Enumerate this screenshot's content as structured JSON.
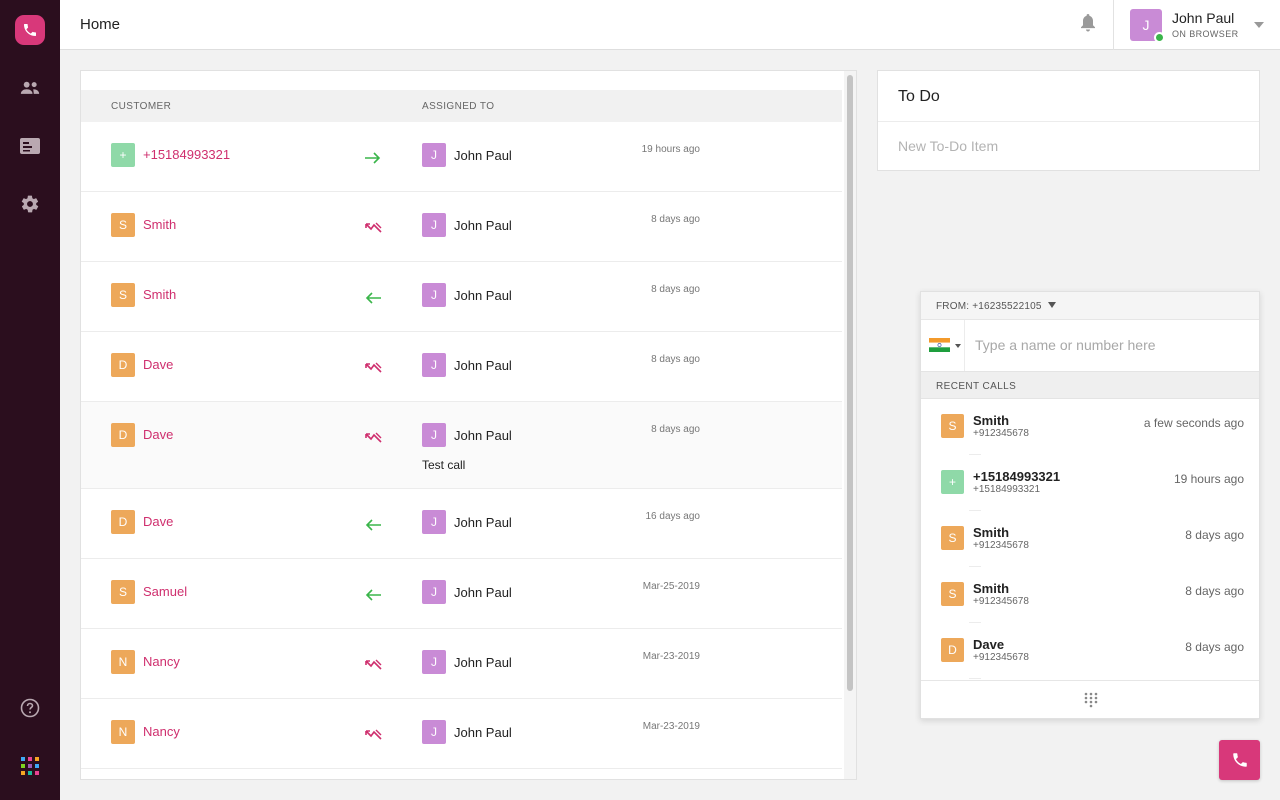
{
  "app": {
    "brand_color": "#d8387a",
    "rail_color": "#2b0e1e",
    "customer_name_color": "#cf2f6e",
    "nav": [
      {
        "icon": "phone-logo-icon"
      },
      {
        "icon": "contacts-icon"
      },
      {
        "icon": "contact-card-icon"
      },
      {
        "icon": "settings-gear-icon"
      },
      {
        "icon": "help-icon"
      },
      {
        "icon": "apps-grid-icon"
      }
    ]
  },
  "header": {
    "title": "Home",
    "user": {
      "initial": "J",
      "name": "John Paul",
      "status": "ON BROWSER",
      "status_color": "#3ab54a"
    }
  },
  "activity": {
    "columns": {
      "customer": "CUSTOMER",
      "assigned_to": "ASSIGNED TO"
    },
    "rows": [
      {
        "initial": "+",
        "avatar_color": "#8fd9a8",
        "customer": "+15184993321",
        "direction": "outgoing",
        "assignee_initial": "J",
        "assignee": "John Paul",
        "time": "19 hours ago",
        "note": ""
      },
      {
        "initial": "S",
        "avatar_color": "#eda85a",
        "customer": "Smith",
        "direction": "missed",
        "assignee_initial": "J",
        "assignee": "John Paul",
        "time": "8 days ago",
        "note": ""
      },
      {
        "initial": "S",
        "avatar_color": "#eda85a",
        "customer": "Smith",
        "direction": "incoming",
        "assignee_initial": "J",
        "assignee": "John Paul",
        "time": "8 days ago",
        "note": ""
      },
      {
        "initial": "D",
        "avatar_color": "#eda85a",
        "customer": "Dave",
        "direction": "missed",
        "assignee_initial": "J",
        "assignee": "John Paul",
        "time": "8 days ago",
        "note": ""
      },
      {
        "initial": "D",
        "avatar_color": "#eda85a",
        "customer": "Dave",
        "direction": "missed",
        "assignee_initial": "J",
        "assignee": "John Paul",
        "time": "8 days ago",
        "note": "Test call"
      },
      {
        "initial": "D",
        "avatar_color": "#eda85a",
        "customer": "Dave",
        "direction": "incoming",
        "assignee_initial": "J",
        "assignee": "John Paul",
        "time": "16 days ago",
        "note": ""
      },
      {
        "initial": "S",
        "avatar_color": "#eda85a",
        "customer": "Samuel",
        "direction": "incoming",
        "assignee_initial": "J",
        "assignee": "John Paul",
        "time": "Mar-25-2019",
        "note": ""
      },
      {
        "initial": "N",
        "avatar_color": "#eda85a",
        "customer": "Nancy",
        "direction": "missed",
        "assignee_initial": "J",
        "assignee": "John Paul",
        "time": "Mar-23-2019",
        "note": ""
      },
      {
        "initial": "N",
        "avatar_color": "#eda85a",
        "customer": "Nancy",
        "direction": "missed",
        "assignee_initial": "J",
        "assignee": "John Paul",
        "time": "Mar-23-2019",
        "note": ""
      }
    ]
  },
  "todo": {
    "title": "To Do",
    "placeholder": "New To-Do Item"
  },
  "dialer": {
    "from_label": "FROM: +16235522105",
    "country": "India",
    "search_placeholder": "Type a name or number here",
    "recent_label": "RECENT CALLS",
    "recent": [
      {
        "initial": "S",
        "avatar_color": "#eda85a",
        "name": "Smith",
        "number": "+912345678",
        "time": "a few seconds ago"
      },
      {
        "initial": "+",
        "avatar_color": "#8fd9a8",
        "name": "+15184993321",
        "number": "+15184993321",
        "time": "19 hours ago"
      },
      {
        "initial": "S",
        "avatar_color": "#eda85a",
        "name": "Smith",
        "number": "+912345678",
        "time": "8 days ago"
      },
      {
        "initial": "S",
        "avatar_color": "#eda85a",
        "name": "Smith",
        "number": "+912345678",
        "time": "8 days ago"
      },
      {
        "initial": "D",
        "avatar_color": "#eda85a",
        "name": "Dave",
        "number": "+912345678",
        "time": "8 days ago"
      }
    ]
  }
}
